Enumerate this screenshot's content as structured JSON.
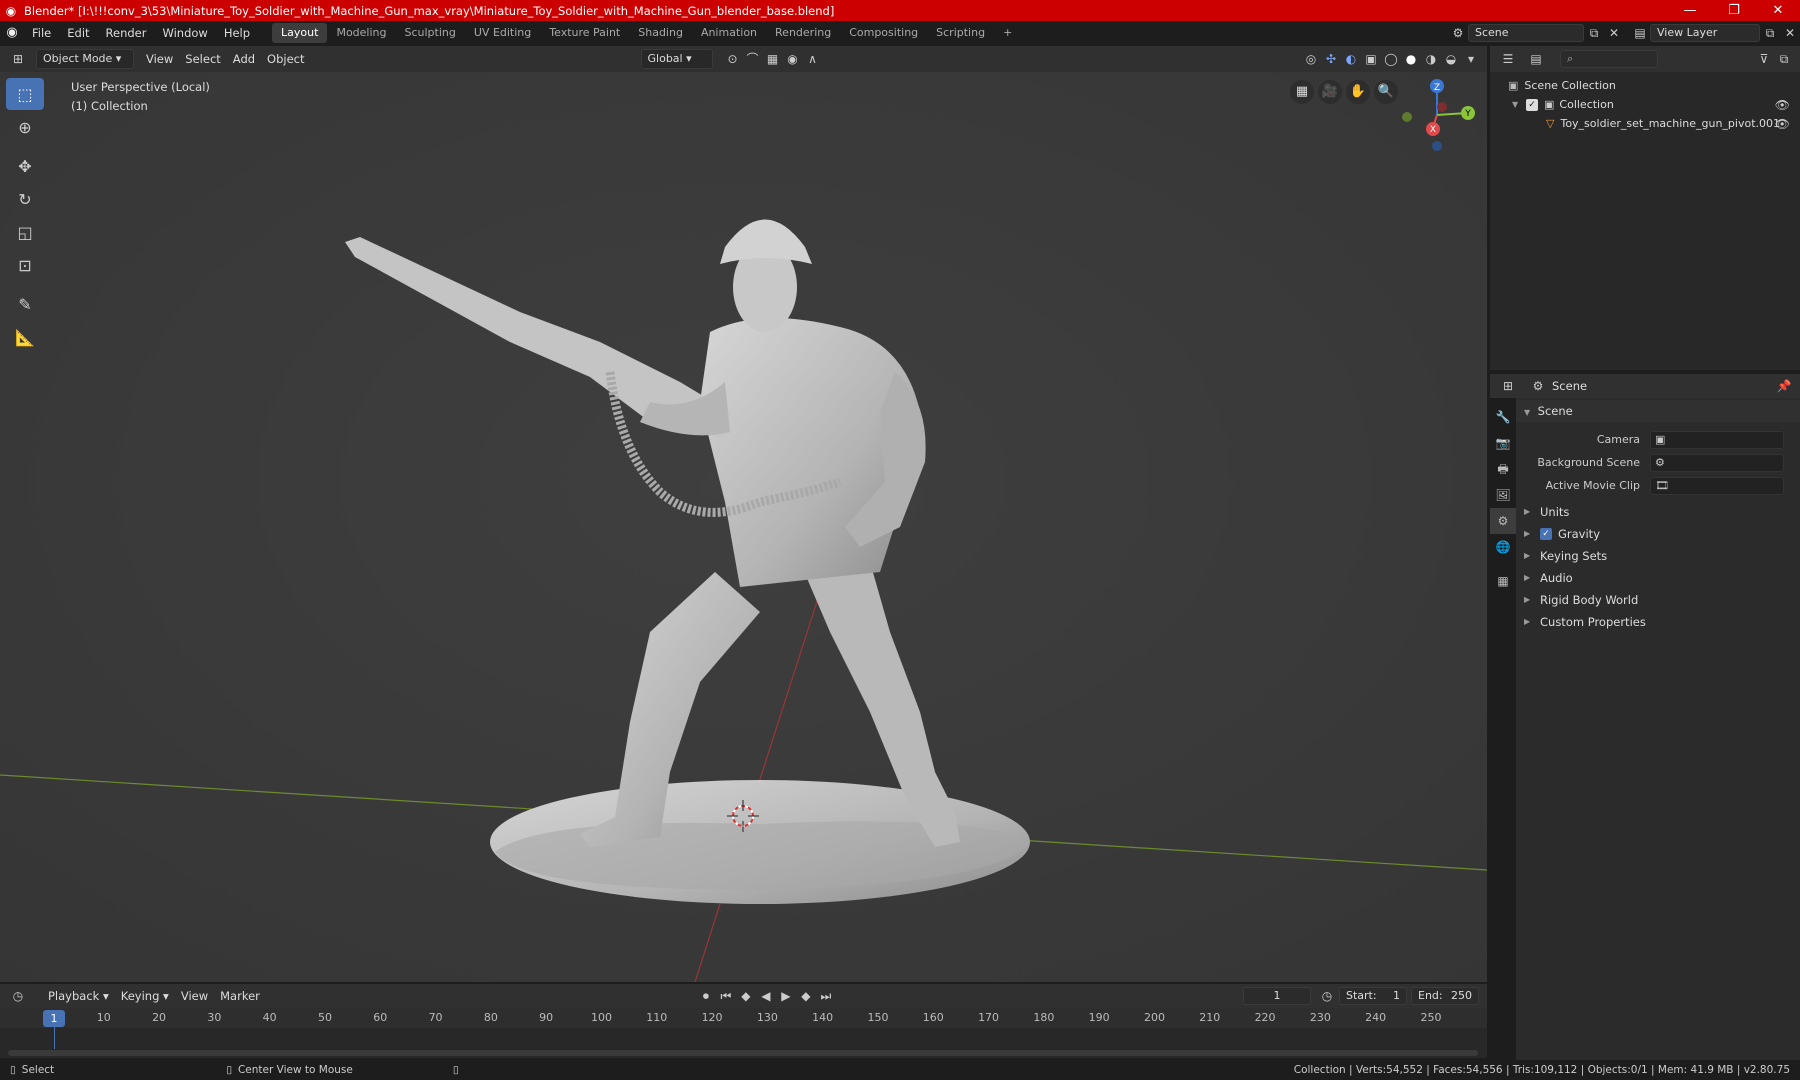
{
  "window": {
    "title": "Blender* [I:\\!!!conv_3\\53\\Miniature_Toy_Soldier_with_Machine_Gun_max_vray\\Miniature_Toy_Soldier_with_Machine_Gun_blender_base.blend]",
    "minimize": "—",
    "maximize": "❐",
    "close": "✕"
  },
  "menu": [
    "File",
    "Edit",
    "Render",
    "Window",
    "Help"
  ],
  "workspaces": [
    "Layout",
    "Modeling",
    "Sculpting",
    "UV Editing",
    "Texture Paint",
    "Shading",
    "Animation",
    "Rendering",
    "Compositing",
    "Scripting"
  ],
  "workspace_add": "+",
  "scene_field": "Scene",
  "view_layer_field": "View Layer",
  "viewport_header": {
    "mode": "Object Mode",
    "menus": [
      "View",
      "Select",
      "Add",
      "Object"
    ],
    "orientation": "Global"
  },
  "viewport": {
    "perspective": "User Perspective (Local)",
    "collection": "(1) Collection",
    "gizmo": {
      "z": "Z",
      "y": "Y",
      "x": "X"
    }
  },
  "outliner": {
    "root": "Scene Collection",
    "collection": "Collection",
    "object": "Toy_soldier_set_machine_gun_pivot.001"
  },
  "properties": {
    "header": "Scene",
    "section": "Scene",
    "rows": [
      {
        "label": "Camera",
        "value": ""
      },
      {
        "label": "Background Scene",
        "value": ""
      },
      {
        "label": "Active Movie Clip",
        "value": ""
      }
    ],
    "subsections": [
      "Units",
      "Gravity",
      "Keying Sets",
      "Audio",
      "Rigid Body World",
      "Custom Properties"
    ]
  },
  "timeline": {
    "menus": [
      "Playback",
      "Keying",
      "View",
      "Marker"
    ],
    "current_frame": "1",
    "start_label": "Start:",
    "start": "1",
    "end_label": "End:",
    "end": "250",
    "ticks": [
      "10",
      "20",
      "30",
      "40",
      "50",
      "60",
      "70",
      "80",
      "90",
      "100",
      "110",
      "120",
      "130",
      "140",
      "150",
      "160",
      "170",
      "180",
      "190",
      "200",
      "210",
      "220",
      "230",
      "240",
      "250"
    ],
    "playhead_frame": 1
  },
  "statusbar": {
    "select": "Select",
    "center": "Center View to Mouse",
    "stats": "Collection | Verts:54,552 | Faces:54,556 | Tris:109,112 | Objects:0/1 | Mem: 41.9 MB | v2.80.75"
  },
  "colors": {
    "accent": "#4772b3",
    "title_bar": "#cc0000"
  }
}
